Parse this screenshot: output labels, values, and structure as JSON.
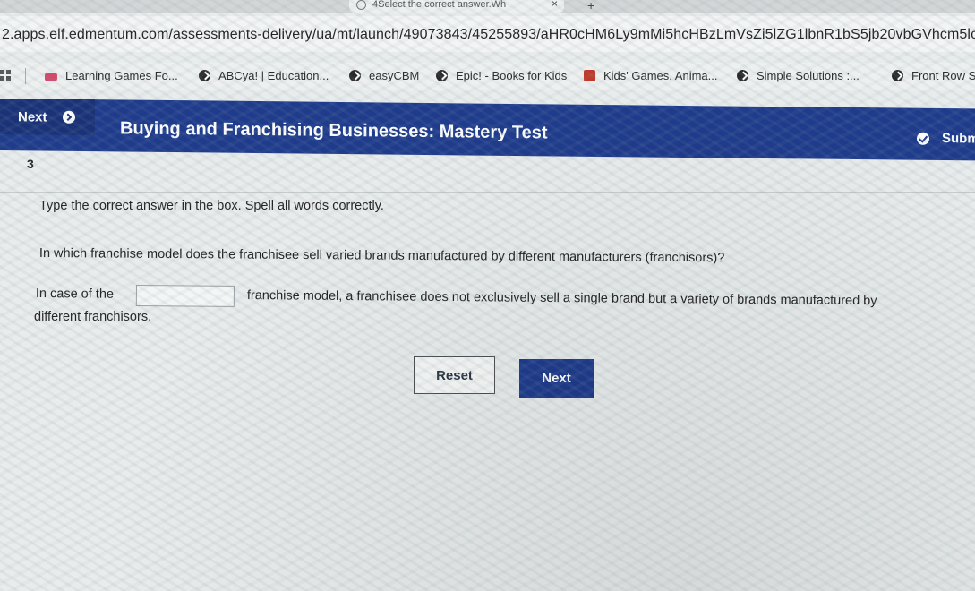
{
  "browser": {
    "tab": {
      "title": "4Select the correct answer.Wh",
      "close_glyph": "×",
      "new_tab_glyph": "+"
    },
    "url": "2.apps.elf.edmentum.com/assessments-delivery/ua/mt/launch/49073843/45255893/aHR0cHM6Ly9mMi5hcHBzLmVsZi5lZG1lbnR1bS5jb20vbGVhcm5lci9zZ",
    "bookmarks": [
      {
        "label": "Learning Games Fo...",
        "icon": "game-icon"
      },
      {
        "label": "ABCya! | Education...",
        "icon": "globe-icon"
      },
      {
        "label": "easyCBM",
        "icon": "globe-icon"
      },
      {
        "label": "Epic! - Books for Kids",
        "icon": "globe-icon"
      },
      {
        "label": "Kids' Games, Anima...",
        "icon": "bookmark-icon"
      },
      {
        "label": "Simple Solutions :...",
        "icon": "globe-icon"
      },
      {
        "label": "Front Row S",
        "icon": "globe-icon"
      }
    ]
  },
  "header": {
    "next_label": "Next",
    "title": "Buying and Franchising Businesses: Mastery Test",
    "submit_label": "Subm"
  },
  "question": {
    "number": "3",
    "instruction": "Type the correct answer in the box. Spell all words correctly.",
    "prompt": "In which franchise model does the franchisee sell varied brands manufactured by different manufacturers (franchisors)?",
    "answer_before": "In case of the",
    "answer_value": "",
    "answer_after": "franchise model, a franchisee does not exclusively sell a single brand but a variety of brands manufactured by",
    "answer_continued": "different franchisors."
  },
  "buttons": {
    "reset_label": "Reset",
    "next_label": "Next"
  },
  "colors": {
    "header_bg": "#1f3b8c",
    "primary_button": "#1f3b8c"
  }
}
